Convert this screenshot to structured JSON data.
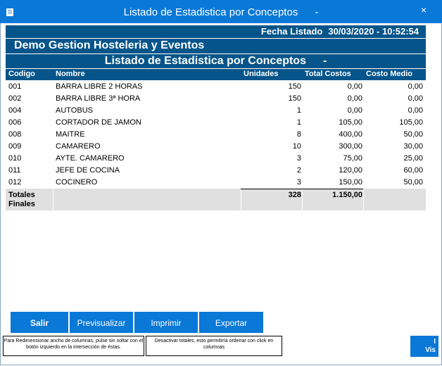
{
  "window": {
    "title": "Listado de Estadistica por Conceptos",
    "title_suffix": "-",
    "close_glyph": "×"
  },
  "report": {
    "fecha_label": "Fecha Listado",
    "fecha_value": "30/03/2020 - 10:52:54",
    "company": "Demo Gestion Hosteleria y Eventos",
    "title": "Listado de Estadistica por Conceptos",
    "title_suffix": "-",
    "columns": [
      "Codigo",
      "Nombre",
      "Unidades",
      "Total Costos",
      "Costo Medio"
    ],
    "rows": [
      {
        "codigo": "001",
        "nombre": "BARRA LIBRE 2 HORAS",
        "unidades": "150",
        "total": "0,00",
        "medio": "0,00"
      },
      {
        "codigo": "002",
        "nombre": "BARRA LIBRE 3ª HORA",
        "unidades": "150",
        "total": "0,00",
        "medio": "0,00"
      },
      {
        "codigo": "004",
        "nombre": "AUTOBUS",
        "unidades": "1",
        "total": "0,00",
        "medio": "0,00"
      },
      {
        "codigo": "006",
        "nombre": "CORTADOR DE JAMON",
        "unidades": "1",
        "total": "105,00",
        "medio": "105,00"
      },
      {
        "codigo": "008",
        "nombre": "MAITRE",
        "unidades": "8",
        "total": "400,00",
        "medio": "50,00"
      },
      {
        "codigo": "009",
        "nombre": "CAMARERO",
        "unidades": "10",
        "total": "300,00",
        "medio": "30,00"
      },
      {
        "codigo": "010",
        "nombre": "AYTE. CAMARERO",
        "unidades": "3",
        "total": "75,00",
        "medio": "25,00"
      },
      {
        "codigo": "011",
        "nombre": "JEFE DE COCINA",
        "unidades": "2",
        "total": "120,00",
        "medio": "60,00"
      },
      {
        "codigo": "012",
        "nombre": "COCINERO",
        "unidades": "3",
        "total": "150,00",
        "medio": "50,00"
      }
    ],
    "totals": {
      "label_line1": "Totales",
      "label_line2": "Finales",
      "unidades": "328",
      "total": "1.150,00"
    }
  },
  "buttons": {
    "salir": "Salir",
    "previsualizar": "Previsualizar",
    "imprimir": "Imprimir",
    "exportar": "Exportar",
    "small_line1": "I",
    "small_line2": "Vis"
  },
  "notes": {
    "resize": "Para Redimensionar ancho de columnas, pulse sin soltar con el botón izquierdo en la intersección de éstas.",
    "totals": "Desactivar totales, esto permitiría ordenar con click en columnas"
  },
  "colors": {
    "titlebar": "#0a78d7",
    "report_header": "#06558a",
    "button": "#0a78d7",
    "totals_bg": "#e0e0e0"
  }
}
